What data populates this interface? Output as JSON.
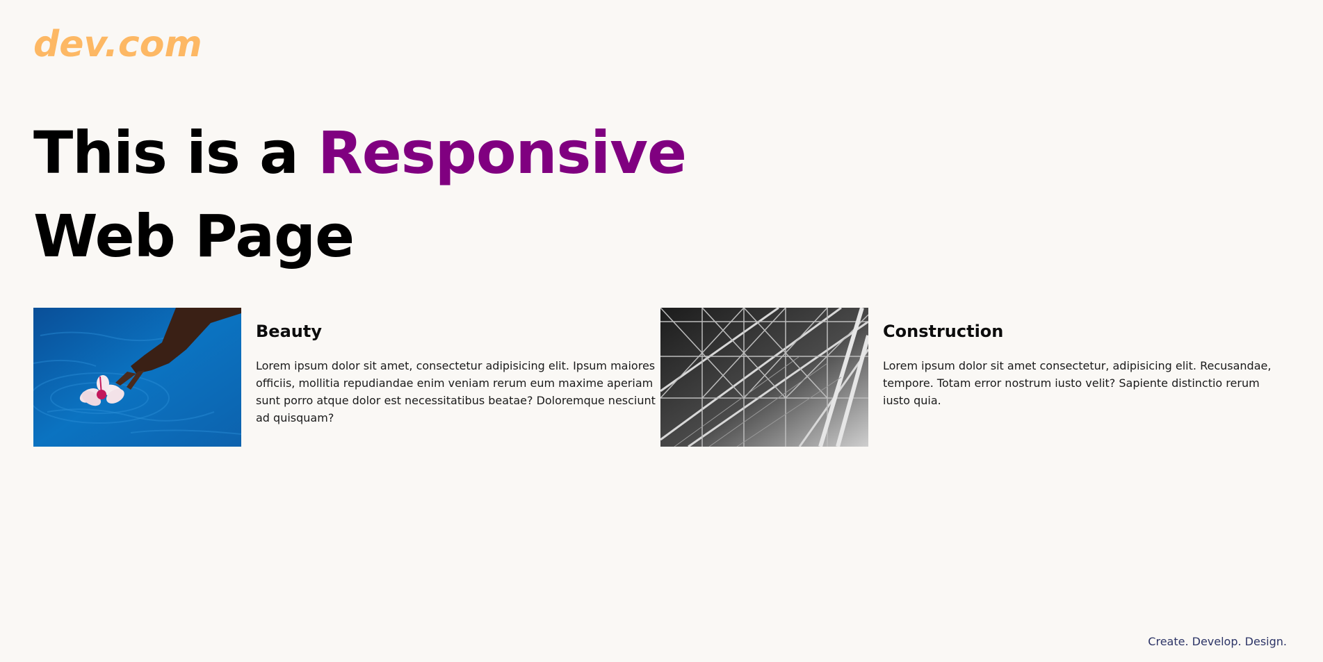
{
  "brand": {
    "logo": "dev.com",
    "accent_color": "#fdb864"
  },
  "hero": {
    "line1_prefix": "This is a ",
    "line1_accent": "Responsive",
    "line2": "Web Page",
    "accent_color": "#800080"
  },
  "cards": [
    {
      "title": "Beauty",
      "text": "Lorem ipsum dolor sit amet, consectetur adipisicing elit. Ipsum maiores officiis, mollitia repudiandae enim veniam rerum eum maxime aperiam sunt porro atque dolor est necessitatibus beatae? Doloremque nesciunt ad quisquam?",
      "image_icon": "flower-on-water-image"
    },
    {
      "title": "Construction",
      "text": "Lorem ipsum dolor sit amet consectetur, adipisicing elit. Recusandae, tempore. Totam error nostrum iusto velit? Sapiente distinctio rerum iusto quia.",
      "image_icon": "steel-structure-image"
    }
  ],
  "footer": {
    "tagline": "Create. Develop. Design."
  }
}
